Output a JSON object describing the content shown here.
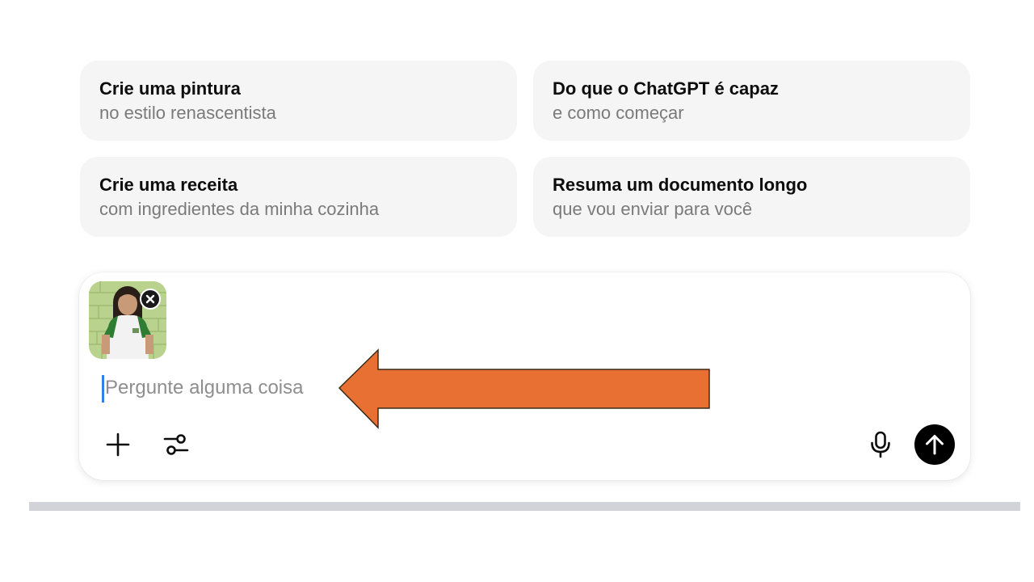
{
  "suggestions": [
    {
      "title": "Crie uma pintura",
      "subtitle": "no estilo renascentista"
    },
    {
      "title": "Do que o ChatGPT é capaz",
      "subtitle": "e como começar"
    },
    {
      "title": "Crie uma receita",
      "subtitle": "com ingredientes da minha cozinha"
    },
    {
      "title": "Resuma um documento longo",
      "subtitle": "que vou enviar para você"
    }
  ],
  "composer": {
    "placeholder": "Pergunte alguma coisa",
    "value": "",
    "attachment": {
      "type": "image",
      "remove_icon": "close-icon"
    },
    "left_actions": [
      {
        "icon": "plus-icon"
      },
      {
        "icon": "sliders-icon"
      }
    ],
    "right_actions": [
      {
        "icon": "microphone-icon"
      },
      {
        "icon": "arrow-up-icon"
      }
    ]
  },
  "colors": {
    "card_bg": "#f5f5f5",
    "caret": "#2f80ed",
    "send_button": "#000000",
    "annotation_arrow": "#e87033",
    "annotation_outline": "#3a2a1a",
    "divider": "#d2d3d8"
  }
}
